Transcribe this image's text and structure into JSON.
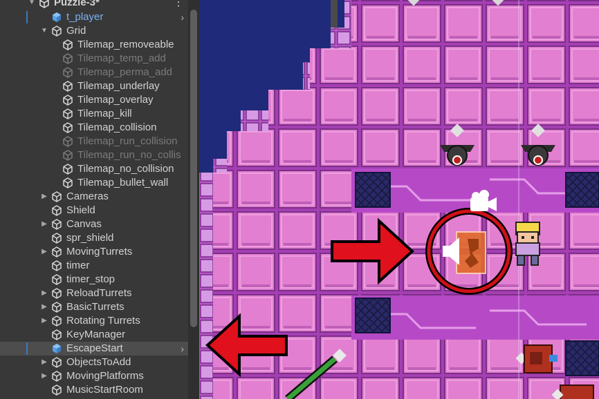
{
  "scene_title": "Puzzle-3*",
  "hierarchy": [
    {
      "label": "t_player",
      "indent": 1,
      "icon": "prefab-cube-icon",
      "prefab": true,
      "chevron": true,
      "selmark": true
    },
    {
      "label": "Grid",
      "indent": 1,
      "icon": "cube-icon",
      "fold": "open"
    },
    {
      "label": "Tilemap_removeable",
      "indent": 2,
      "icon": "cube-icon"
    },
    {
      "label": "Tilemap_temp_add",
      "indent": 2,
      "icon": "cube-icon",
      "disabled": true
    },
    {
      "label": "Tilemap_perma_add",
      "indent": 2,
      "icon": "cube-icon",
      "disabled": true
    },
    {
      "label": "Tilemap_underlay",
      "indent": 2,
      "icon": "cube-icon"
    },
    {
      "label": "Tilemap_overlay",
      "indent": 2,
      "icon": "cube-icon"
    },
    {
      "label": "Tilemap_kill",
      "indent": 2,
      "icon": "cube-icon"
    },
    {
      "label": "Tilemap_collision",
      "indent": 2,
      "icon": "cube-icon"
    },
    {
      "label": "Tilemap_run_collision",
      "indent": 2,
      "icon": "cube-icon",
      "disabled": true
    },
    {
      "label": "Tilemap_run_no_collis",
      "indent": 2,
      "icon": "cube-icon",
      "disabled": true
    },
    {
      "label": "Tilemap_no_collision",
      "indent": 2,
      "icon": "cube-icon"
    },
    {
      "label": "Tilemap_bullet_wall",
      "indent": 2,
      "icon": "cube-icon"
    },
    {
      "label": "Cameras",
      "indent": 1,
      "icon": "cube-icon",
      "fold": "closed"
    },
    {
      "label": "Shield",
      "indent": 1,
      "icon": "cube-icon"
    },
    {
      "label": "Canvas",
      "indent": 1,
      "icon": "cube-icon",
      "fold": "closed"
    },
    {
      "label": "spr_shield",
      "indent": 1,
      "icon": "cube-icon"
    },
    {
      "label": "MovingTurrets",
      "indent": 1,
      "icon": "cube-icon",
      "fold": "closed"
    },
    {
      "label": "timer",
      "indent": 1,
      "icon": "cube-icon"
    },
    {
      "label": "timer_stop",
      "indent": 1,
      "icon": "cube-icon"
    },
    {
      "label": "ReloadTurrets",
      "indent": 1,
      "icon": "cube-icon",
      "fold": "closed"
    },
    {
      "label": "BasicTurrets",
      "indent": 1,
      "icon": "cube-icon",
      "fold": "closed"
    },
    {
      "label": "Rotating Turrets",
      "indent": 1,
      "icon": "cube-icon",
      "fold": "closed"
    },
    {
      "label": "KeyManager",
      "indent": 1,
      "icon": "cube-icon"
    },
    {
      "label": "EscapeStart",
      "indent": 1,
      "icon": "prefab-cube-icon",
      "selected": true,
      "chevron": true,
      "selmark": true
    },
    {
      "label": "ObjectsToAdd",
      "indent": 1,
      "icon": "cube-icon",
      "fold": "closed"
    },
    {
      "label": "MovingPlatforms",
      "indent": 1,
      "icon": "cube-icon",
      "fold": "closed"
    },
    {
      "label": "MusicStartRoom",
      "indent": 1,
      "icon": "cube-icon"
    }
  ],
  "colors": {
    "panel_bg": "#383838",
    "selected_row": "#4d4d4d",
    "prefab_text": "#7cb1f2",
    "disabled_text": "#7b7b7b",
    "tile_pink": "#e27fd0",
    "tile_border": "#7a2f86",
    "grid_bg": "#b03ac0",
    "water_blue": "#1f2a7a",
    "arrow_red": "#e0101c",
    "circle_red": "#d01018"
  },
  "icons": {
    "ellipsis": "⋮",
    "chevron": "›",
    "fold_open": "▼",
    "fold_closed": "▶"
  }
}
